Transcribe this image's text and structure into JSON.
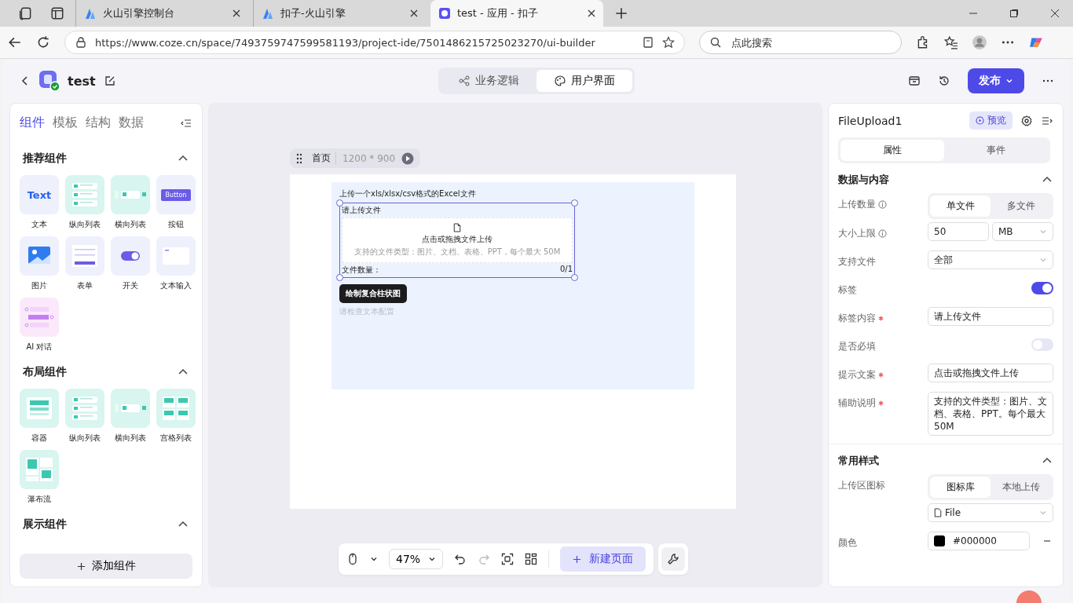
{
  "browser": {
    "tabs": [
      {
        "title": "火山引擎控制台",
        "selected": false
      },
      {
        "title": "扣子-火山引擎",
        "selected": false
      },
      {
        "title": "test - 应用 - 扣子",
        "selected": true
      }
    ],
    "url": "https://www.coze.cn/space/7493759747599581193/project-ide/7501486215725023270/ui-builder",
    "search": {
      "placeholder": "点此搜索"
    }
  },
  "header": {
    "project": "test",
    "modes": [
      {
        "label": "业务逻辑",
        "selected": false
      },
      {
        "label": "用户界面",
        "selected": true
      }
    ],
    "publish": "发布"
  },
  "left_panel": {
    "tabs": [
      {
        "label": "组件",
        "selected": true
      },
      {
        "label": "模板",
        "selected": false
      },
      {
        "label": "结构",
        "selected": false
      },
      {
        "label": "数据",
        "selected": false
      }
    ],
    "sections": [
      {
        "title": "推荐组件",
        "expanded": true,
        "items": [
          {
            "label": "文本",
            "kind": "text",
            "icon_text": "Text"
          },
          {
            "label": "纵向列表",
            "kind": "vlist"
          },
          {
            "label": "横向列表",
            "kind": "hlist"
          },
          {
            "label": "按钮",
            "kind": "button",
            "icon_text": "Button"
          },
          {
            "label": "图片",
            "kind": "image"
          },
          {
            "label": "表单",
            "kind": "form"
          },
          {
            "label": "开关",
            "kind": "switch"
          },
          {
            "label": "文本输入",
            "kind": "input"
          },
          {
            "label": "AI 对话",
            "kind": "chat"
          }
        ]
      },
      {
        "title": "布局组件",
        "expanded": true,
        "items": [
          {
            "label": "容器",
            "kind": "container"
          },
          {
            "label": "纵向列表",
            "kind": "vlist"
          },
          {
            "label": "横向列表",
            "kind": "hlist"
          },
          {
            "label": "宫格列表",
            "kind": "grid"
          },
          {
            "label": "瀑布流",
            "kind": "waterfall"
          }
        ]
      },
      {
        "title": "展示组件",
        "expanded": true
      }
    ],
    "add_button": "添加组件"
  },
  "canvas": {
    "page_name": "首页",
    "page_size": "1200 * 900",
    "content": {
      "title": "上传一个xls/xlsx/csv格式的Excel文件",
      "upload": {
        "label": "请上传文件",
        "hint": "点击或拖拽文件上传",
        "help": "支持的文件类型：图片、文档、表格、PPT，每个最大 50M",
        "count_label": "文件数量：",
        "count": "0/1",
        "selected": true
      },
      "button": "绘制复合柱状图",
      "placeholder_text": "请检查文本配置"
    },
    "zoom": "47%",
    "new_page": "新建页面"
  },
  "right_panel": {
    "component": "FileUpload1",
    "preview": "预览",
    "tabs": [
      {
        "label": "属性",
        "selected": true
      },
      {
        "label": "事件",
        "selected": false
      }
    ],
    "sections": [
      {
        "title": "数据与内容",
        "expanded": true,
        "rows": [
          {
            "label": "上传数量",
            "info": true,
            "required": false,
            "kind": "segmented",
            "options": [
              {
                "label": "单文件",
                "selected": true
              },
              {
                "label": "多文件",
                "selected": false
              }
            ]
          },
          {
            "label": "大小上限",
            "info": true,
            "required": false,
            "kind": "number_unit",
            "value": "50",
            "unit": "MB"
          },
          {
            "label": "支持文件",
            "info": false,
            "required": false,
            "kind": "select",
            "value": "全部"
          },
          {
            "label": "标签",
            "info": false,
            "required": false,
            "kind": "switch",
            "on": true
          },
          {
            "label": "标签内容",
            "info": false,
            "required": true,
            "kind": "input",
            "value": "请上传文件"
          },
          {
            "label": "是否必填",
            "info": false,
            "required": false,
            "kind": "switch",
            "on": false
          },
          {
            "label": "提示文案",
            "info": false,
            "required": true,
            "kind": "input",
            "value": "点击或拖拽文件上传"
          },
          {
            "label": "辅助说明",
            "info": false,
            "required": true,
            "kind": "textarea",
            "value": "支持的文件类型：图片、文档、表格、PPT。每个最大50M"
          }
        ]
      },
      {
        "title": "常用样式",
        "expanded": true,
        "rows": [
          {
            "label": "上传区图标",
            "info": false,
            "required": false,
            "kind": "segmented",
            "options": [
              {
                "label": "图标库",
                "selected": true
              },
              {
                "label": "本地上传",
                "selected": false
              }
            ]
          },
          {
            "info": false,
            "required": false,
            "kind": "icon_select",
            "value": "File"
          },
          {
            "label": "颜色",
            "info": false,
            "required": false,
            "kind": "color",
            "value": "#000000"
          }
        ]
      }
    ]
  }
}
